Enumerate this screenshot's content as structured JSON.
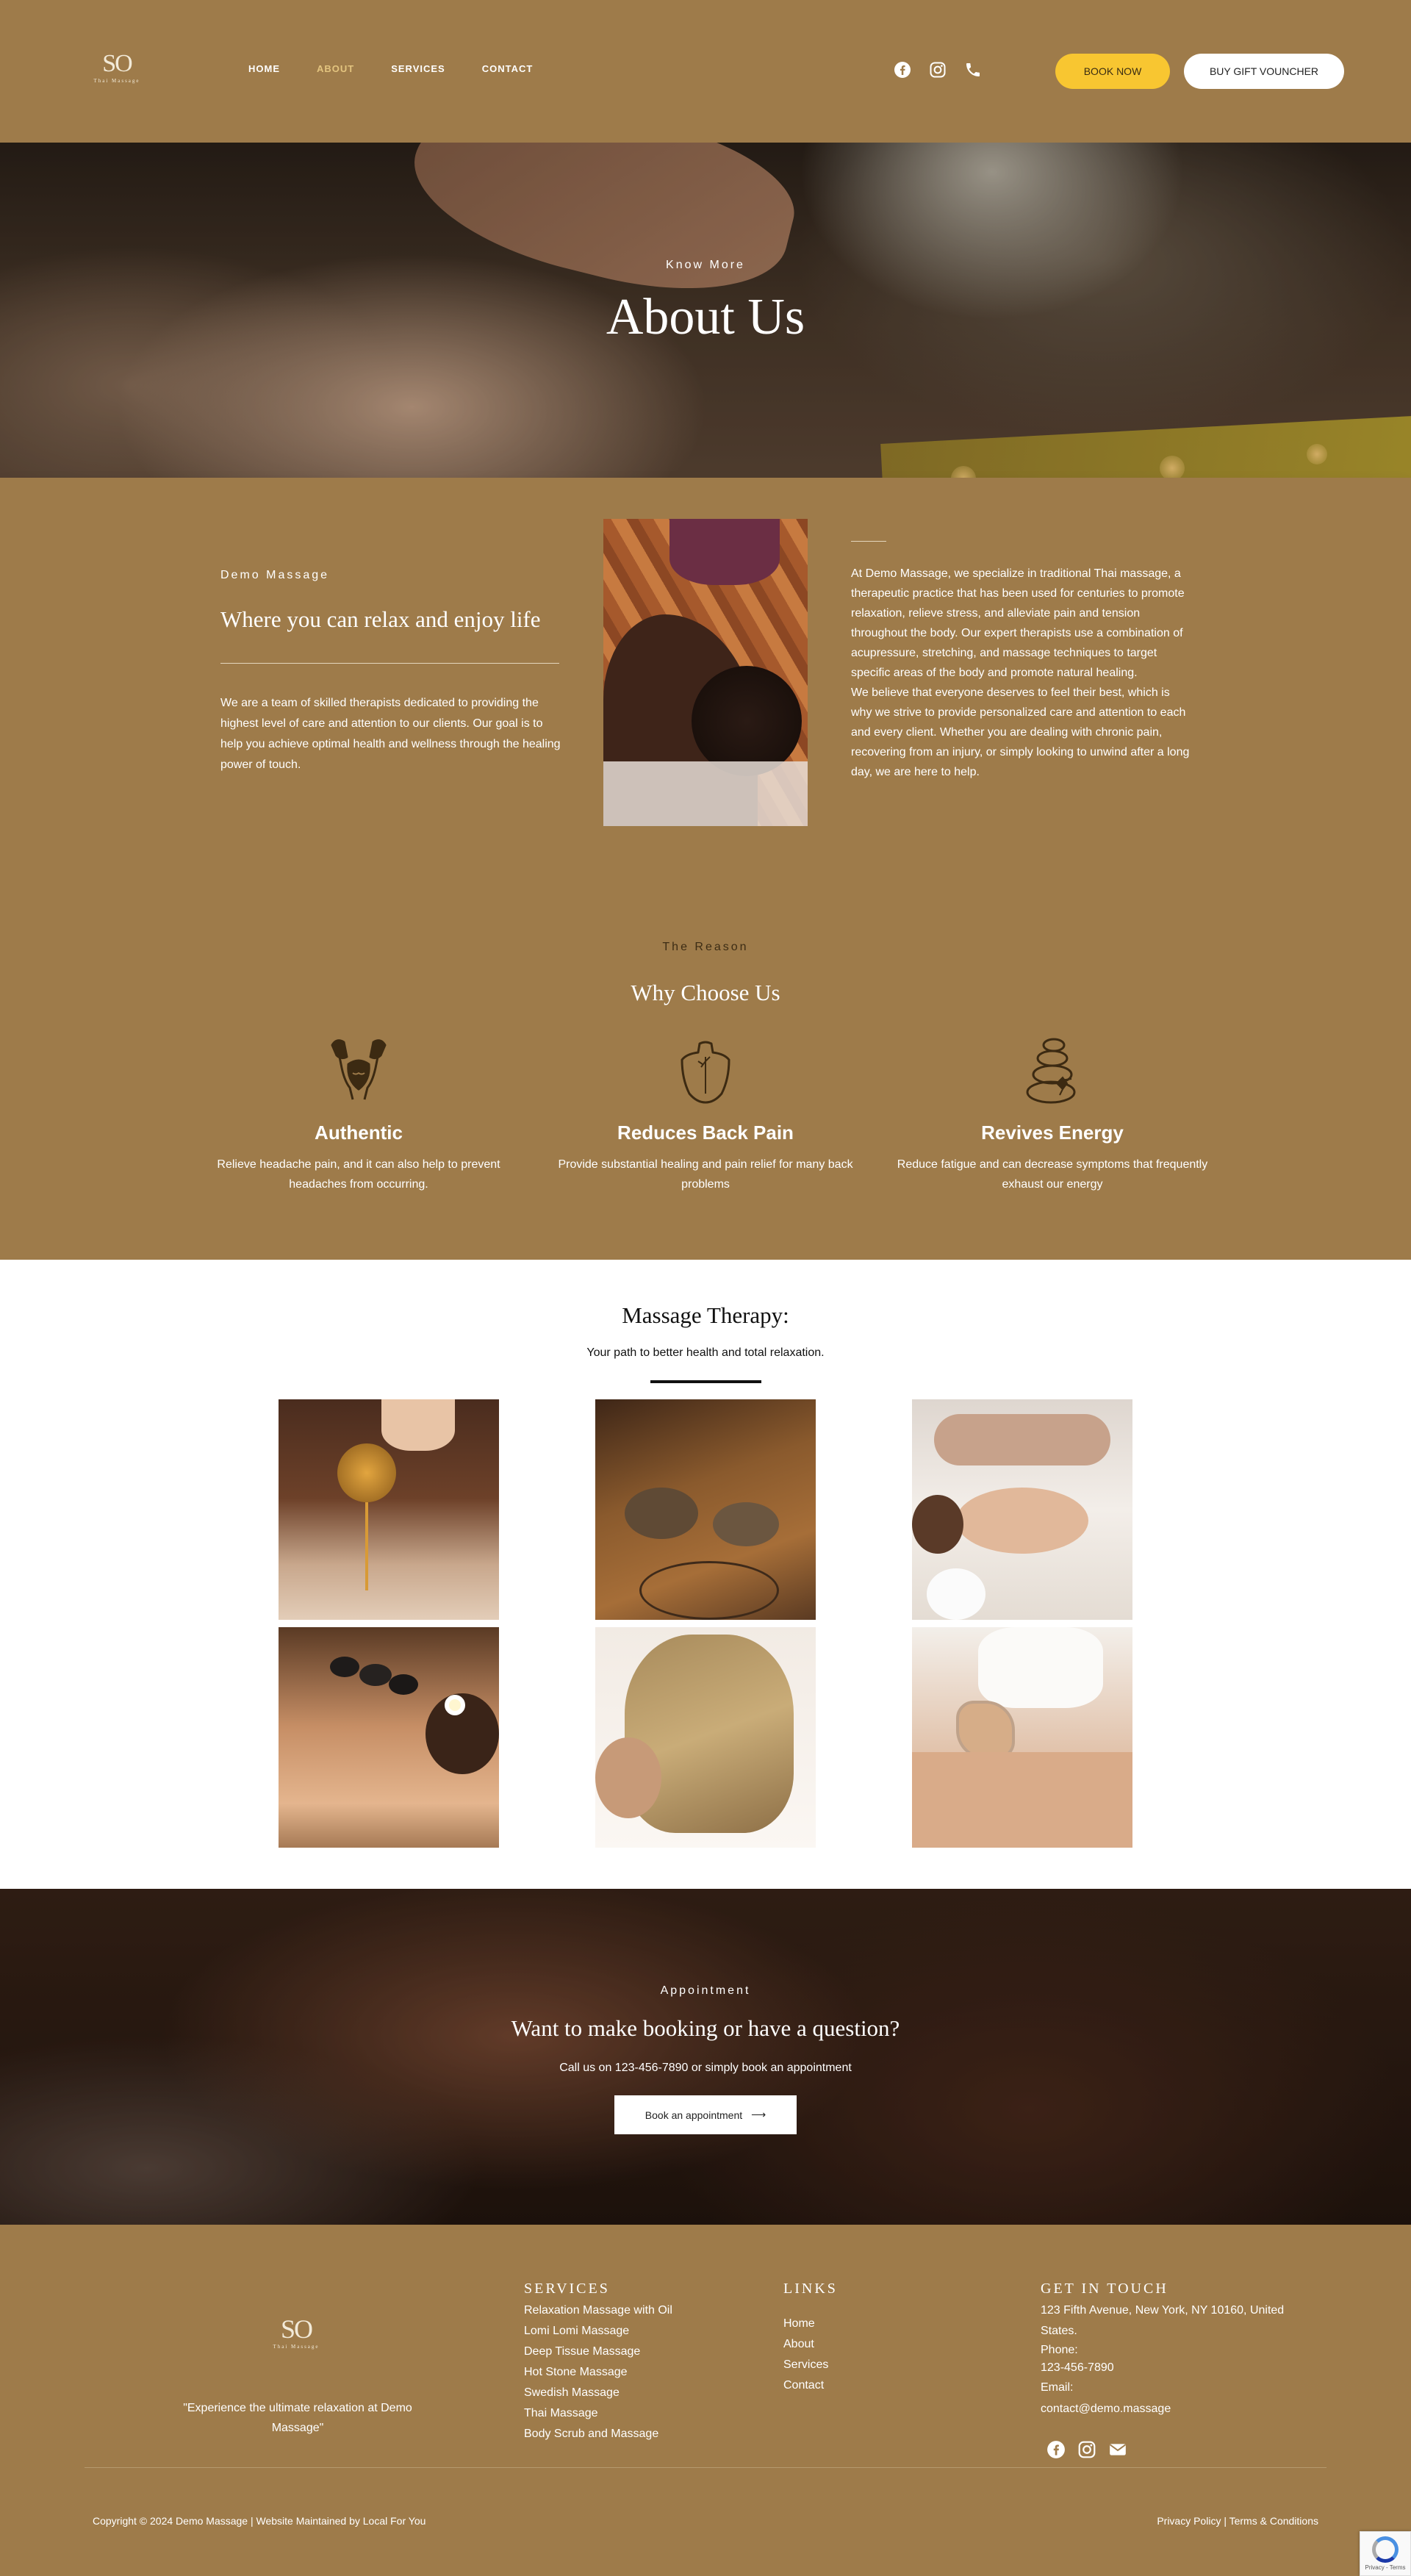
{
  "brand": {
    "logo_mark": "SO",
    "logo_sub": "Thai Massage"
  },
  "nav": {
    "items": [
      {
        "label": "HOME",
        "active": false
      },
      {
        "label": "ABOUT",
        "active": true
      },
      {
        "label": "SERVICES",
        "active": false
      },
      {
        "label": "CONTACT",
        "active": false
      }
    ],
    "social_icons": [
      "facebook-icon",
      "instagram-icon",
      "phone-icon"
    ],
    "book_label": "BOOK NOW",
    "gift_label": "BUY GIFT VOUNCHER"
  },
  "hero": {
    "kicker": "Know More",
    "title": "About Us"
  },
  "about": {
    "kicker": "Demo Massage",
    "heading": "Where you can relax and enjoy life",
    "body": "We are a team of skilled therapists dedicated to providing the highest level of care and attention to our clients. Our goal is to help you achieve optimal health and wellness through the healing power of touch.",
    "paragraph1": "At Demo Massage, we specialize in traditional Thai massage, a therapeutic practice that has been used for centuries to promote relaxation, relieve stress, and alleviate pain and tension throughout the body. Our expert therapists use a combination of acupressure, stretching, and massage techniques to target specific areas of the body and promote natural healing.",
    "paragraph2": "We believe that everyone deserves to feel their best, which is why we strive to provide personalized care and attention to each and every client. Whether you are dealing with chronic pain, recovering from an injury, or simply looking to unwind after a long day, we are here to help."
  },
  "why": {
    "kicker": "The Reason",
    "title": "Why Choose Us",
    "features": [
      {
        "icon": "head-massage-icon",
        "title": "Authentic",
        "text": "Relieve headache pain, and it can also help to prevent headaches from occurring."
      },
      {
        "icon": "back-torso-icon",
        "title": "Reduces Back Pain",
        "text": "Provide substantial healing and pain relief for many back problems"
      },
      {
        "icon": "hot-stones-icon",
        "title": "Revives Energy",
        "text": "Reduce fatigue and can decrease symptoms that frequently exhaust our energy"
      }
    ]
  },
  "therapy": {
    "title": "Massage Therapy:",
    "subtitle": "Your path to better health and total relaxation."
  },
  "appointment": {
    "kicker": "Appointment",
    "title": "Want to make booking or have a question?",
    "subtitle": "Call us on 123-456-7890 or simply book an appointment",
    "button_label": "Book an appointment",
    "button_arrow": "⟶"
  },
  "footer": {
    "quote": "\"Experience the ultimate relaxation at Demo Massage\"",
    "services_heading": "SERVICES",
    "services": [
      "Relaxation Massage with Oil",
      "Lomi Lomi Massage",
      "Deep Tissue Massage",
      "Hot Stone Massage",
      "Swedish Massage",
      "Thai Massage",
      "Body Scrub and Massage"
    ],
    "links_heading": "LINKS",
    "links": [
      "Home",
      "About",
      "Services",
      "Contact"
    ],
    "contact_heading": "GET IN TOUCH",
    "address": "123 Fifth Avenue, New York, NY 10160, United States.",
    "phone_label": "Phone:",
    "phone": "123-456-7890",
    "email_label": "Email:",
    "email": "contact@demo.massage",
    "social_icons": [
      "facebook-icon",
      "instagram-icon",
      "envelope-icon"
    ],
    "copyright": "Copyright © 2024 Demo Massage | Website Maintained by Local For You",
    "legal": "Privacy Policy | Terms & Conditions",
    "recaptcha": "Privacy - Terms"
  },
  "colors": {
    "brown": "#9e7b4a",
    "accent_yellow": "#f8c631",
    "active_nav": "#e3c47f",
    "icon_dark": "#3c2a12"
  }
}
